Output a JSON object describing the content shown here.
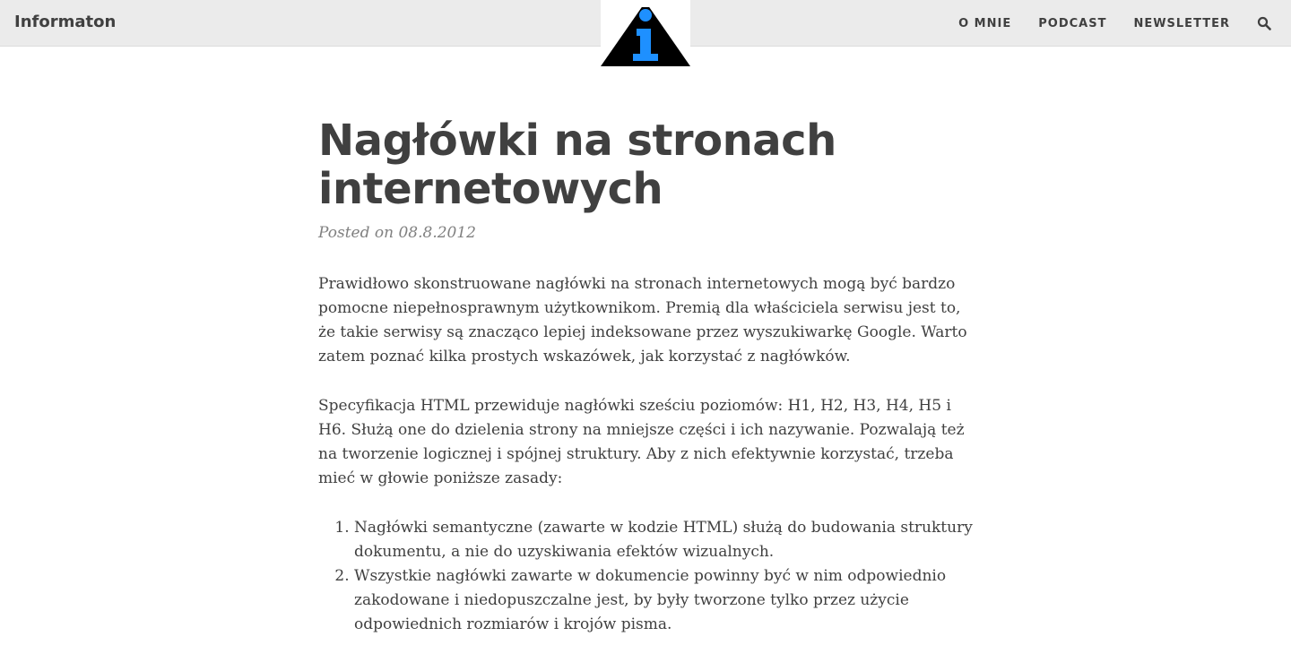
{
  "navbar": {
    "brand": "Informaton",
    "logo_icon": "info-triangle-logo",
    "links": [
      "O MNIE",
      "PODCAST",
      "NEWSLETTER"
    ],
    "search_icon": "search-icon"
  },
  "post": {
    "title": "Nagłówki na stronach internetowych",
    "meta": "Posted on 08.8.2012",
    "paragraphs": [
      "Prawidłowo skonstruowane nagłówki na stronach internetowych mogą być bardzo pomocne niepełnosprawnym użytkownikom. Premią dla właściciela serwisu jest to, że takie serwisy są znacząco lepiej indeksowane przez wyszukiwarkę Google. Warto zatem poznać kilka prostych wskazówek, jak korzystać z nagłówków.",
      "Specyfikacja HTML przewiduje nagłówki sześciu poziomów: H1, H2, H3, H4, H5 i H6. Służą one do dzielenia strony na mniejsze części i ich nazywanie. Pozwalają też na tworzenie logicznej i spójnej struktury. Aby z nich efektywnie korzystać, trzeba mieć w głowie poniższe zasady:"
    ],
    "list": [
      "Nagłówki semantyczne (zawarte w kodzie HTML) służą do budowania struktury dokumentu, a nie do uzyskiwania efektów wizualnych.",
      "Wszystkie nagłówki zawarte w dokumencie powinny być w nim odpowiednio zakodowane i niedopuszczalne jest, by były tworzone tylko przez użycie odpowiednich rozmiarów i krojów pisma."
    ]
  },
  "colors": {
    "navbar_bg": "#ebebeb",
    "text": "#404040",
    "meta": "#808080",
    "logo_blue": "#1e90ff"
  }
}
